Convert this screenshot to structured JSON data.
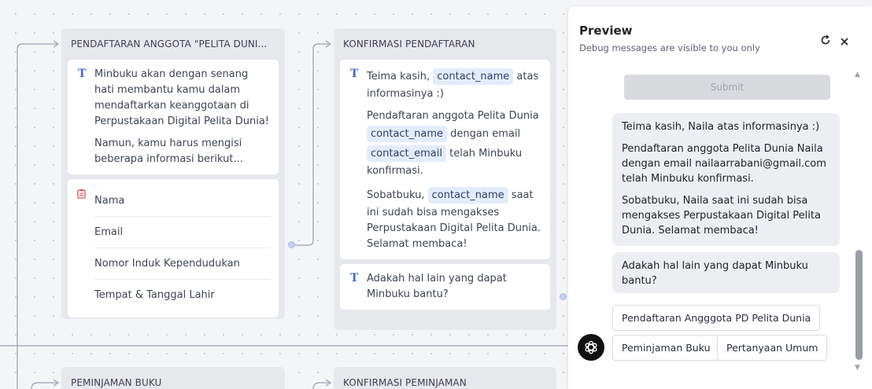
{
  "canvas": {
    "nodes": [
      {
        "title": "PENDAFTARAN ANGGOTA \"PELITA DUNI...",
        "message_paragraphs": [
          "Minbuku akan dengan senang hati membantu kamu dalam mendaftarkan keanggotaan di Perpustakaan Digital Pelita Dunia!",
          "Namun, kamu harus mengisi beberapa informasi berikut..."
        ],
        "form_fields": [
          "Nama",
          "Email",
          "Nomor Induk Kependudukan",
          "Tempat & Tanggal Lahir"
        ]
      },
      {
        "title": "KONFIRMASI PENDAFTARAN",
        "p1_before": "Teima kasih, ",
        "p1_var": "contact_name",
        "p1_after": " atas informasinya :)",
        "p2_before": "Pendaftaran anggota Pelita Dunia ",
        "p2_var1": "contact_name",
        "p2_mid": " dengan email ",
        "p2_var2": "contact_email",
        "p2_after": " telah Minbuku konfirmasi.",
        "p3_before": "Sobatbuku, ",
        "p3_var": "contact_name",
        "p3_after": " saat ini sudah bisa mengakses Perpustakaan Digital Pelita Dunia. Selamat membaca!",
        "message2": "Adakah hal lain yang dapat Minbuku bantu?"
      },
      {
        "title": "PEMINJAMAN BUKU"
      },
      {
        "title": "KONFIRMASI PEMINJAMAN"
      }
    ],
    "icons": {
      "text_block": "T",
      "form_block": "form-icon"
    }
  },
  "preview": {
    "title": "Preview",
    "subtitle": "Debug messages are visible to you only",
    "submit_label": "Submit",
    "bubble1": [
      "Teima kasih, Naila atas informasinya :)",
      "Pendaftaran anggota Pelita Dunia Naila dengan email nailaarrabani@gmail.com telah Minbuku konfirmasi.",
      "Sobatbuku, Naila saat ini sudah bisa mengakses Perpustakaan Digital Pelita Dunia. Selamat membaca!"
    ],
    "bubble2": "Adakah hal lain yang dapat Minbuku bantu?",
    "quick_replies": [
      "Pendaftaran Angggota PD Pelita Dunia",
      "Peminjaman Buku",
      "Pertanyaan Umum"
    ],
    "icons": {
      "refresh": "refresh-icon",
      "close": "close-icon",
      "avatar": "bot-avatar-icon"
    }
  },
  "colors": {
    "accent": "#3f6bd8",
    "variable_bg": "#e3ecfb",
    "port": "#c7cdf0"
  }
}
